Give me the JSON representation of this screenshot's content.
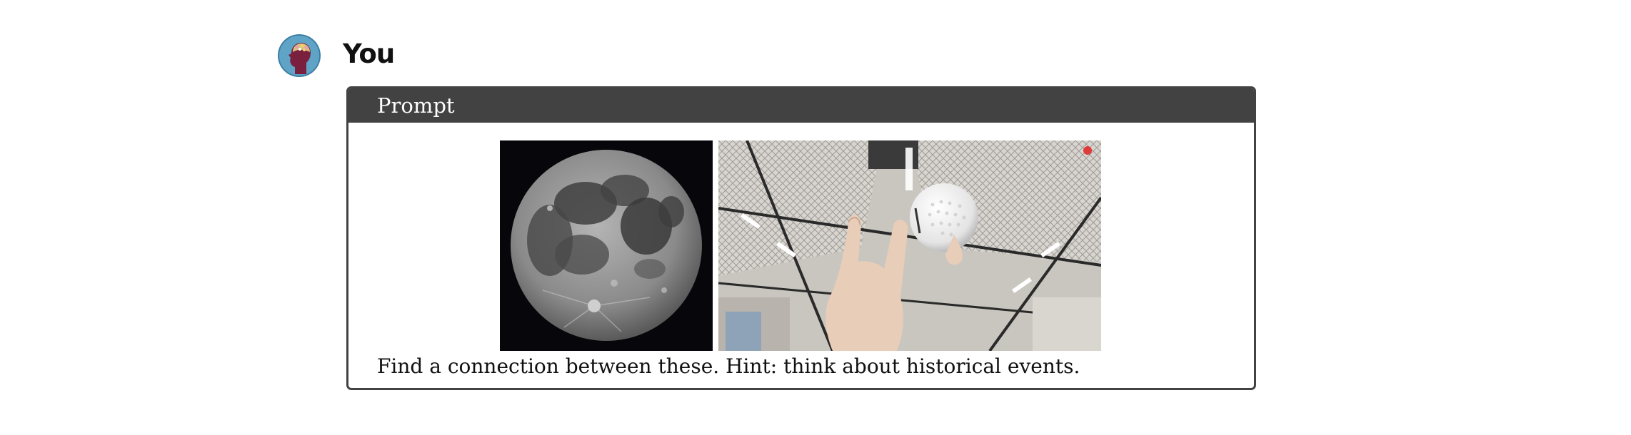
{
  "user": {
    "name": "You",
    "avatar_icon": "brain-profile-avatar"
  },
  "prompt": {
    "header": "Prompt",
    "images": [
      {
        "subject": "full moon",
        "icon": "moon-image"
      },
      {
        "subject": "hand holding a golf ball",
        "icon": "golf-ball-image"
      }
    ],
    "text": "Find a connection between these. Hint: think about historical events."
  },
  "colors": {
    "header_bg": "#424242",
    "border": "#424242",
    "avatar_bg": "#5fa3c7"
  }
}
